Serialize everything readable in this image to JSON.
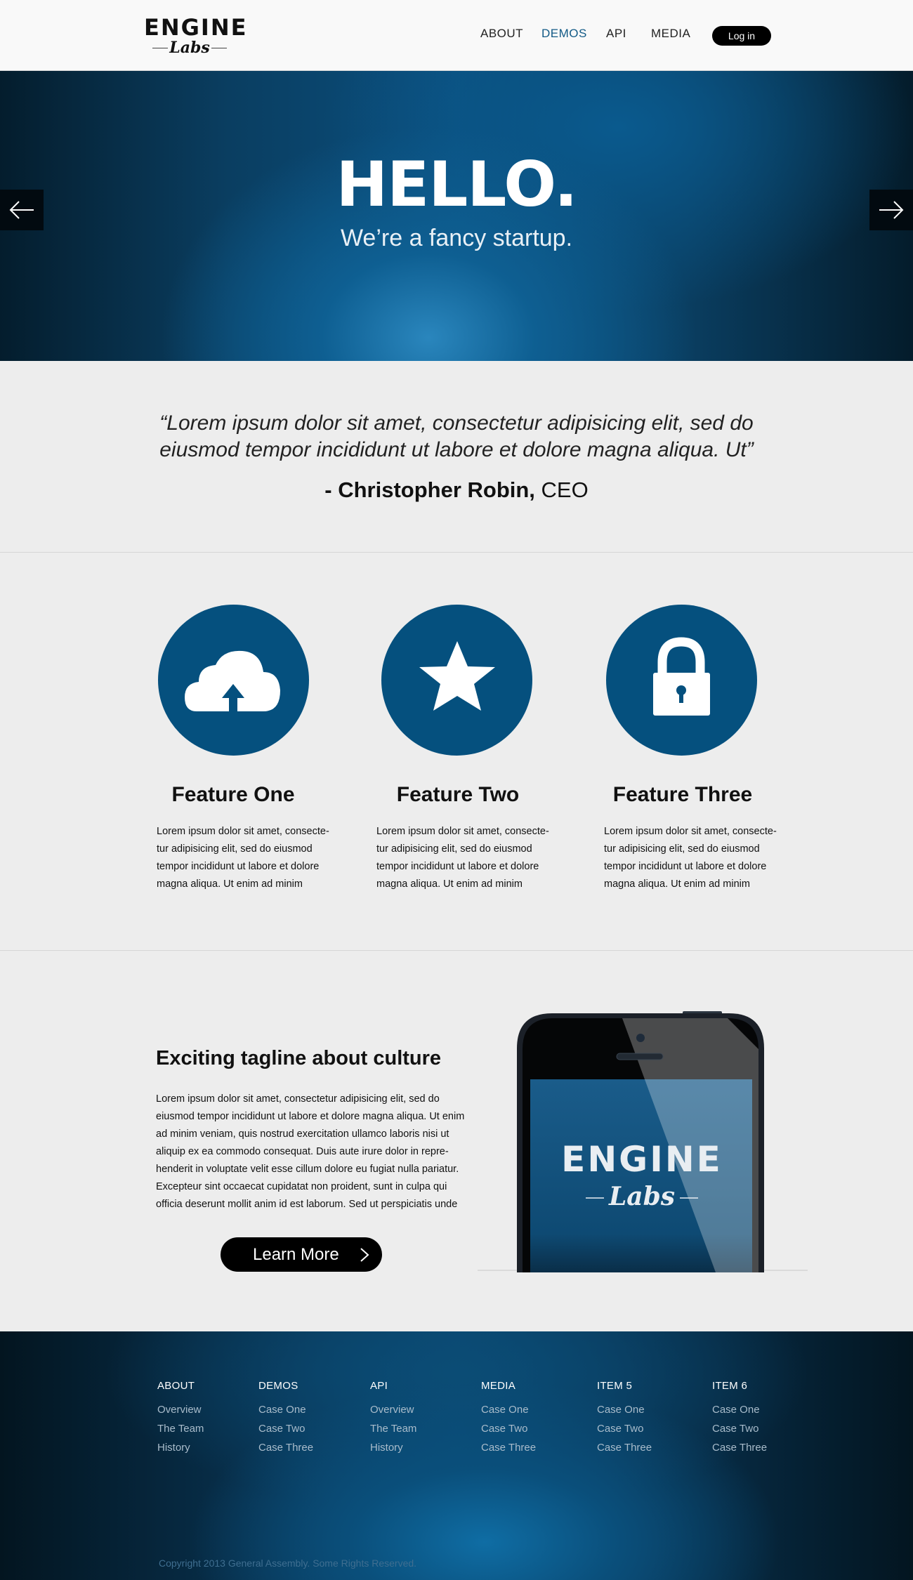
{
  "header": {
    "logo_top": "ENGINE",
    "logo_bottom": "Labs",
    "nav": [
      {
        "label": "ABOUT"
      },
      {
        "label": "DEMOS"
      },
      {
        "label": "API"
      },
      {
        "label": "MEDIA"
      }
    ],
    "active_nav": "DEMOS",
    "login_label": "Log in"
  },
  "hero": {
    "title": "HELLO.",
    "subtitle": "We’re a fancy startup.",
    "prev_icon": "arrow-left-icon",
    "next_icon": "arrow-right-icon"
  },
  "quote": {
    "line1": "“Lorem ipsum dolor sit amet, consectetur adipisicing elit, sed do",
    "line2": "eiusmod tempor incididunt ut labore et dolore magna aliqua. Ut”",
    "author_name": "- Christopher Robin,",
    "author_role": "CEO"
  },
  "features": [
    {
      "icon": "cloud-upload-icon",
      "title": "Feature One",
      "text": "Lorem ipsum dolor sit amet, consecte-tur adipisicing elit, sed do eiusmod tempor incididunt ut labore et dolore magna aliqua. Ut enim ad minim"
    },
    {
      "icon": "star-icon",
      "title": "Feature Two",
      "text": "Lorem ipsum dolor sit amet, consecte-tur adipisicing elit, sed do eiusmod tempor incididunt ut labore et dolore magna aliqua. Ut enim ad minim"
    },
    {
      "icon": "lock-icon",
      "title": "Feature Three",
      "text": "Lorem ipsum dolor sit amet, consecte-tur adipisicing elit, sed do eiusmod tempor incididunt ut labore et dolore magna aliqua. Ut enim ad minim"
    }
  ],
  "culture": {
    "title": "Exciting tagline about culture",
    "text": "Lorem ipsum dolor sit amet, consectetur adipisicing elit, sed do eiusmod tempor incididunt ut labore et dolore magna aliqua. Ut enim ad minim veniam, quis nostrud exercitation ullamco laboris nisi ut aliquip ex ea commodo consequat. Duis aute irure dolor in repre-henderit in voluptate velit esse cillum dolore eu fugiat nulla pariatur. Excepteur sint occaecat cupidatat non proident, sunt in culpa qui officia deserunt mollit anim id est laborum. Sed ut perspiciatis unde",
    "button_label": "Learn More",
    "phone_logo_top": "ENGINE",
    "phone_logo_bottom": "Labs"
  },
  "footer": {
    "columns": [
      {
        "heading": "ABOUT",
        "links": [
          "Overview",
          "The Team",
          "History"
        ]
      },
      {
        "heading": "DEMOS",
        "links": [
          "Case One",
          "Case Two",
          "Case Three"
        ]
      },
      {
        "heading": "API",
        "links": [
          "Overview",
          "The Team",
          "History"
        ]
      },
      {
        "heading": "MEDIA",
        "links": [
          "Case One",
          "Case Two",
          "Case Three"
        ]
      },
      {
        "heading": "ITEM 5",
        "links": [
          "Case One",
          "Case Two",
          "Case Three"
        ]
      },
      {
        "heading": "ITEM 6",
        "links": [
          "Case One",
          "Case Two",
          "Case Three"
        ]
      }
    ],
    "copyright": "Copyright 2013 General Assembly. Some Rights Reserved."
  },
  "colors": {
    "brand_blue": "#05507e",
    "nav_active": "#125a86",
    "footer_link": "#a9bccb"
  }
}
